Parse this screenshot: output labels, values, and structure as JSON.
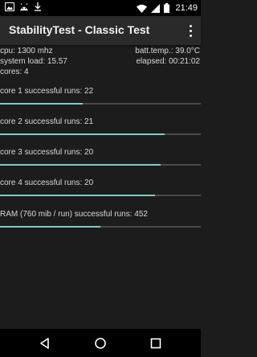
{
  "status_bar": {
    "clock": "21:49",
    "left_icons": [
      "image-icon",
      "android-icon",
      "download-icon"
    ],
    "right_icons": [
      "wifi-icon",
      "signal-icon",
      "battery-icon"
    ]
  },
  "toolbar": {
    "title": "StabilityTest - Classic Test"
  },
  "info": {
    "cpu": "cpu: 1300 mhz",
    "batt_temp": "batt.temp.: 39.0°C",
    "system_load": "system load: 15.57",
    "elapsed": "elapsed: 00:21:02",
    "cores": "cores: 4"
  },
  "tests": [
    {
      "label": "core 1 successful runs: 22",
      "progress": 0.41
    },
    {
      "label": "core 2 successful runs: 21",
      "progress": 0.82
    },
    {
      "label": "core 3 successful runs: 20",
      "progress": 0.8
    },
    {
      "label": "core 4 successful runs: 20",
      "progress": 0.77
    },
    {
      "label": "RAM (760 mib / run) successful runs: 452",
      "progress": 0.5
    }
  ],
  "colors": {
    "accent": "#80cbc4",
    "track": "#4a4a4a",
    "background": "#1c1c1c",
    "toolbar": "#2a2a2a"
  },
  "nav_bar": [
    "back-icon",
    "home-icon",
    "recents-icon"
  ]
}
